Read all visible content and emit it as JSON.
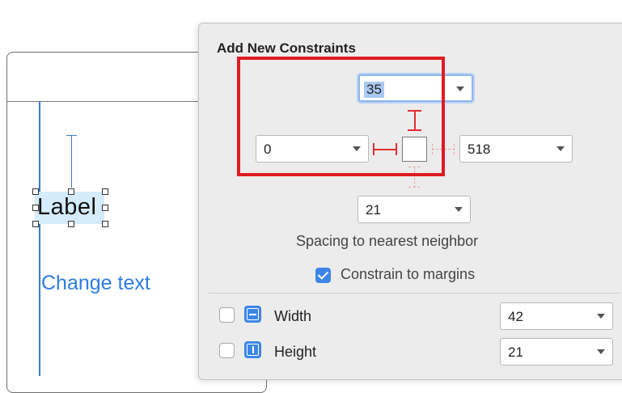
{
  "canvas": {
    "label_text": "Label",
    "change_text": "Change text"
  },
  "panel": {
    "title": "Add New Constraints",
    "top_value": "35",
    "left_value": "0",
    "right_value": "518",
    "bottom_value": "21",
    "spacing_label": "Spacing to nearest neighbor",
    "constrain_label": "Constrain to margins",
    "constrain_checked": true,
    "width_label": "Width",
    "width_value": "42",
    "width_checked": false,
    "height_label": "Height",
    "height_value": "21",
    "height_checked": false
  },
  "colors": {
    "accent": "#3d86e8",
    "highlight": "#e01b22",
    "constraint_active": "#e03030",
    "link_text": "#2e7ce0"
  },
  "icons": {
    "width_icon": "width-constraint-icon",
    "height_icon": "height-constraint-icon",
    "dropdown": "chevron-down-icon"
  }
}
